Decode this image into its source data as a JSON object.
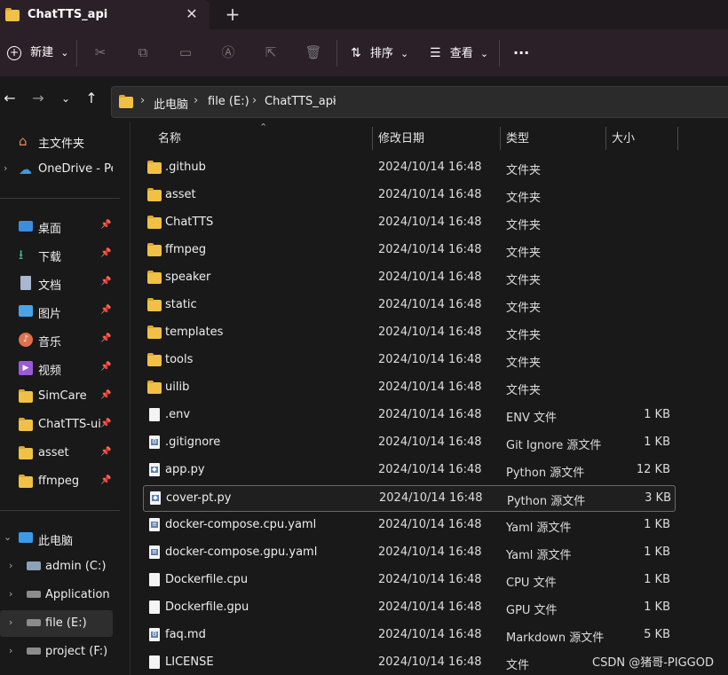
{
  "window": {
    "tab_title": "ChatTTS_api",
    "tab_close": "✕",
    "new_tab": "+"
  },
  "toolbar": {
    "new_label": "新建",
    "sort_label": "排序",
    "view_label": "查看",
    "more_label": "···",
    "chevron": "⌄"
  },
  "address": {
    "crumbs": [
      "此电脑",
      "file (E:)",
      "ChatTTS_api"
    ],
    "sep": "›"
  },
  "sidebar": {
    "home": "主文件夹",
    "onedrive": "OneDrive - Per",
    "pinned": [
      "桌面",
      "下载",
      "文档",
      "图片",
      "音乐",
      "视频",
      "SimCare",
      "ChatTTS-ui-",
      "asset",
      "ffmpeg"
    ],
    "this_pc": "此电脑",
    "drives": [
      "admin (C:)",
      "Application (I",
      "file (E:)",
      "project (F:)"
    ]
  },
  "columns": {
    "name": "名称",
    "date": "修改日期",
    "type": "类型",
    "size": "大小"
  },
  "files": [
    {
      "name": ".github",
      "date": "2024/10/14 16:48",
      "type": "文件夹",
      "size": "",
      "kind": "folder"
    },
    {
      "name": "asset",
      "date": "2024/10/14 16:48",
      "type": "文件夹",
      "size": "",
      "kind": "folder"
    },
    {
      "name": "ChatTTS",
      "date": "2024/10/14 16:48",
      "type": "文件夹",
      "size": "",
      "kind": "folder"
    },
    {
      "name": "ffmpeg",
      "date": "2024/10/14 16:48",
      "type": "文件夹",
      "size": "",
      "kind": "folder"
    },
    {
      "name": "speaker",
      "date": "2024/10/14 16:48",
      "type": "文件夹",
      "size": "",
      "kind": "folder"
    },
    {
      "name": "static",
      "date": "2024/10/14 16:48",
      "type": "文件夹",
      "size": "",
      "kind": "folder"
    },
    {
      "name": "templates",
      "date": "2024/10/14 16:48",
      "type": "文件夹",
      "size": "",
      "kind": "folder"
    },
    {
      "name": "tools",
      "date": "2024/10/14 16:48",
      "type": "文件夹",
      "size": "",
      "kind": "folder"
    },
    {
      "name": "uilib",
      "date": "2024/10/14 16:48",
      "type": "文件夹",
      "size": "",
      "kind": "folder"
    },
    {
      "name": ".env",
      "date": "2024/10/14 16:48",
      "type": "ENV 文件",
      "size": "1 KB",
      "kind": "file"
    },
    {
      "name": ".gitignore",
      "date": "2024/10/14 16:48",
      "type": "Git Ignore 源文件",
      "size": "1 KB",
      "kind": "gear"
    },
    {
      "name": "app.py",
      "date": "2024/10/14 16:48",
      "type": "Python 源文件",
      "size": "12 KB",
      "kind": "py"
    },
    {
      "name": "cover-pt.py",
      "date": "2024/10/14 16:48",
      "type": "Python 源文件",
      "size": "3 KB",
      "kind": "py"
    },
    {
      "name": "docker-compose.cpu.yaml",
      "date": "2024/10/14 16:48",
      "type": "Yaml 源文件",
      "size": "1 KB",
      "kind": "doc"
    },
    {
      "name": "docker-compose.gpu.yaml",
      "date": "2024/10/14 16:48",
      "type": "Yaml 源文件",
      "size": "1 KB",
      "kind": "doc"
    },
    {
      "name": "Dockerfile.cpu",
      "date": "2024/10/14 16:48",
      "type": "CPU 文件",
      "size": "1 KB",
      "kind": "file"
    },
    {
      "name": "Dockerfile.gpu",
      "date": "2024/10/14 16:48",
      "type": "GPU 文件",
      "size": "1 KB",
      "kind": "file"
    },
    {
      "name": "faq.md",
      "date": "2024/10/14 16:48",
      "type": "Markdown 源文件",
      "size": "5 KB",
      "kind": "gear"
    },
    {
      "name": "LICENSE",
      "date": "2024/10/14 16:48",
      "type": "文件",
      "size": "",
      "kind": "file"
    }
  ],
  "watermark": "CSDN @猪哥-PIGGOD",
  "colors": {
    "accent": "#f0c144",
    "background": "#191919",
    "toolbar": "#2b2027"
  }
}
